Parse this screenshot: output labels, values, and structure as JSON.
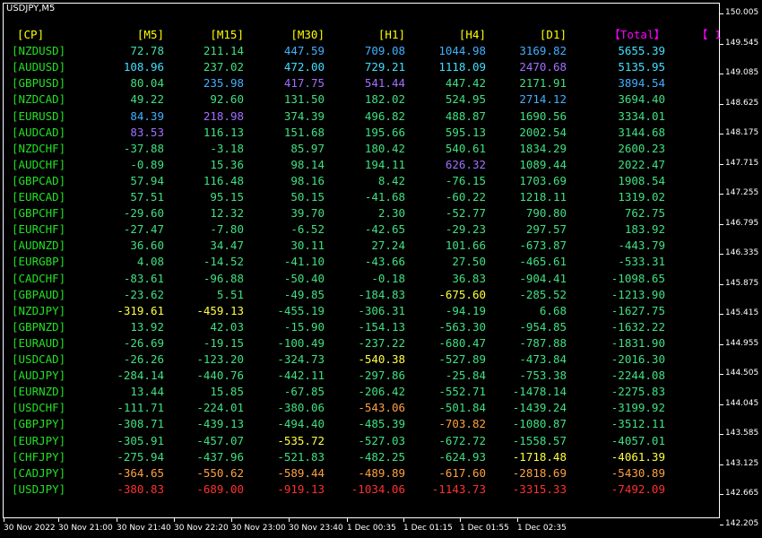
{
  "title": "USDJPY,M5",
  "headers": [
    "[CP]",
    "[M5]",
    "[M15]",
    "[M30]",
    "[H1]",
    "[H4]",
    "[D1]",
    "【Total】",
    "【 1"
  ],
  "header_colors": [
    "#ffff00",
    "#ffff00",
    "#ffff00",
    "#ffff00",
    "#ffff00",
    "#ffff00",
    "#ffff00",
    "#ff00ff",
    "#ff00ff"
  ],
  "rows": [
    {
      "pair": "[NZDUSD]",
      "values": [
        "72.78",
        "211.14",
        "447.59",
        "709.08",
        "1044.98",
        "3169.82",
        "5655.39"
      ],
      "colors": [
        "#40e0b0",
        "#40e080",
        "#40b0ff",
        "#40b0ff",
        "#40b0ff",
        "#40b0ff",
        "#40e0ff"
      ]
    },
    {
      "pair": "[AUDUSD]",
      "values": [
        "108.96",
        "237.02",
        "472.00",
        "729.21",
        "1118.09",
        "2470.68",
        "5135.95"
      ],
      "colors": [
        "#40e0ff",
        "#40e080",
        "#40e0ff",
        "#40e0ff",
        "#40e0ff",
        "#a070ff",
        "#40e0ff"
      ]
    },
    {
      "pair": "[GBPUSD]",
      "values": [
        "80.04",
        "235.98",
        "417.75",
        "541.44",
        "447.42",
        "2171.91",
        "3894.54"
      ],
      "colors": [
        "#40e080",
        "#40b0ff",
        "#a070ff",
        "#a070ff",
        "#40e080",
        "#40e080",
        "#40b0ff"
      ]
    },
    {
      "pair": "[NZDCAD]",
      "values": [
        "49.22",
        "92.60",
        "131.50",
        "182.02",
        "524.95",
        "2714.12",
        "3694.40"
      ],
      "colors": [
        "#40e080",
        "#40e080",
        "#40e080",
        "#40e080",
        "#40e080",
        "#40b0ff",
        "#40e080"
      ]
    },
    {
      "pair": "[EURUSD]",
      "values": [
        "84.39",
        "218.98",
        "374.39",
        "496.82",
        "488.87",
        "1690.56",
        "3334.01"
      ],
      "colors": [
        "#40b0ff",
        "#a070ff",
        "#40e080",
        "#40e080",
        "#40e080",
        "#40e080",
        "#40e080"
      ]
    },
    {
      "pair": "[AUDCAD]",
      "values": [
        "83.53",
        "116.13",
        "151.68",
        "195.66",
        "595.13",
        "2002.54",
        "3144.68"
      ],
      "colors": [
        "#a070ff",
        "#40e080",
        "#40e080",
        "#40e080",
        "#40e080",
        "#40e080",
        "#40e080"
      ]
    },
    {
      "pair": "[NZDCHF]",
      "values": [
        "-37.88",
        "-3.18",
        "85.97",
        "180.42",
        "540.61",
        "1834.29",
        "2600.23"
      ],
      "colors": [
        "#40e080",
        "#40e080",
        "#40e080",
        "#40e080",
        "#40e080",
        "#40e080",
        "#40e080"
      ]
    },
    {
      "pair": "[AUDCHF]",
      "values": [
        "-0.89",
        "15.36",
        "98.14",
        "194.11",
        "626.32",
        "1089.44",
        "2022.47"
      ],
      "colors": [
        "#40e080",
        "#40e080",
        "#40e080",
        "#40e080",
        "#a070ff",
        "#40e080",
        "#40e080"
      ]
    },
    {
      "pair": "[GBPCAD]",
      "values": [
        "57.94",
        "116.48",
        "98.16",
        "8.42",
        "-76.15",
        "1703.69",
        "1908.54"
      ],
      "colors": [
        "#40e080",
        "#40e080",
        "#40e080",
        "#40e080",
        "#40e080",
        "#40e080",
        "#40e080"
      ]
    },
    {
      "pair": "[EURCAD]",
      "values": [
        "57.51",
        "95.15",
        "50.15",
        "-41.68",
        "-60.22",
        "1218.11",
        "1319.02"
      ],
      "colors": [
        "#40e080",
        "#40e080",
        "#40e080",
        "#40e080",
        "#40e080",
        "#40e080",
        "#40e080"
      ]
    },
    {
      "pair": "[GBPCHF]",
      "values": [
        "-29.60",
        "12.32",
        "39.70",
        "2.30",
        "-52.77",
        "790.80",
        "762.75"
      ],
      "colors": [
        "#40e080",
        "#40e080",
        "#40e080",
        "#40e080",
        "#40e080",
        "#40e080",
        "#40e080"
      ]
    },
    {
      "pair": "[EURCHF]",
      "values": [
        "-27.47",
        "-7.80",
        "-6.52",
        "-42.65",
        "-29.23",
        "297.57",
        "183.92"
      ],
      "colors": [
        "#40e080",
        "#40e080",
        "#40e080",
        "#40e080",
        "#40e080",
        "#40e080",
        "#40e080"
      ]
    },
    {
      "pair": "[AUDNZD]",
      "values": [
        "36.60",
        "34.47",
        "30.11",
        "27.24",
        "101.66",
        "-673.87",
        "-443.79"
      ],
      "colors": [
        "#40e080",
        "#40e080",
        "#40e080",
        "#40e080",
        "#40e080",
        "#40e080",
        "#40e080"
      ]
    },
    {
      "pair": "[EURGBP]",
      "values": [
        "4.08",
        "-14.52",
        "-41.10",
        "-43.66",
        "27.50",
        "-465.61",
        "-533.31"
      ],
      "colors": [
        "#40e080",
        "#40e080",
        "#40e080",
        "#40e080",
        "#40e080",
        "#40e080",
        "#40e080"
      ]
    },
    {
      "pair": "[CADCHF]",
      "values": [
        "-83.61",
        "-96.88",
        "-50.40",
        "-0.18",
        "36.83",
        "-904.41",
        "-1098.65"
      ],
      "colors": [
        "#40e080",
        "#40e080",
        "#40e080",
        "#40e080",
        "#40e080",
        "#40e080",
        "#40e080"
      ]
    },
    {
      "pair": "[GBPAUD]",
      "values": [
        "-23.62",
        "5.51",
        "-49.85",
        "-184.83",
        "-675.60",
        "-285.52",
        "-1213.90"
      ],
      "colors": [
        "#40e080",
        "#40e080",
        "#40e080",
        "#40e080",
        "#ffff40",
        "#40e080",
        "#40e080"
      ]
    },
    {
      "pair": "[NZDJPY]",
      "values": [
        "-319.61",
        "-459.13",
        "-455.19",
        "-306.31",
        "-94.19",
        "6.68",
        "-1627.75"
      ],
      "colors": [
        "#ffff40",
        "#ffff40",
        "#40e080",
        "#40e080",
        "#40e080",
        "#40e080",
        "#40e080"
      ]
    },
    {
      "pair": "[GBPNZD]",
      "values": [
        "13.92",
        "42.03",
        "-15.90",
        "-154.13",
        "-563.30",
        "-954.85",
        "-1632.22"
      ],
      "colors": [
        "#40e080",
        "#40e080",
        "#40e080",
        "#40e080",
        "#40e080",
        "#40e080",
        "#40e080"
      ]
    },
    {
      "pair": "[EURAUD]",
      "values": [
        "-26.69",
        "-19.15",
        "-100.49",
        "-237.22",
        "-680.47",
        "-787.88",
        "-1831.90"
      ],
      "colors": [
        "#40e080",
        "#40e080",
        "#40e080",
        "#40e080",
        "#40e080",
        "#40e080",
        "#40e080"
      ]
    },
    {
      "pair": "[USDCAD]",
      "values": [
        "-26.26",
        "-123.20",
        "-324.73",
        "-540.38",
        "-527.89",
        "-473.84",
        "-2016.30"
      ],
      "colors": [
        "#40e080",
        "#40e080",
        "#40e080",
        "#ffff40",
        "#40e080",
        "#40e080",
        "#40e080"
      ]
    },
    {
      "pair": "[AUDJPY]",
      "values": [
        "-284.14",
        "-440.76",
        "-442.11",
        "-297.86",
        "-25.84",
        "-753.38",
        "-2244.08"
      ],
      "colors": [
        "#40e080",
        "#40e080",
        "#40e080",
        "#40e080",
        "#40e080",
        "#40e080",
        "#40e080"
      ]
    },
    {
      "pair": "[EURNZD]",
      "values": [
        "13.44",
        "15.85",
        "-67.85",
        "-206.42",
        "-552.71",
        "-1478.14",
        "-2275.83"
      ],
      "colors": [
        "#40e080",
        "#40e080",
        "#40e080",
        "#40e080",
        "#40e080",
        "#40e080",
        "#40e080"
      ]
    },
    {
      "pair": "[USDCHF]",
      "values": [
        "-111.71",
        "-224.01",
        "-380.06",
        "-543.06",
        "-501.84",
        "-1439.24",
        "-3199.92"
      ],
      "colors": [
        "#40e080",
        "#40e080",
        "#40e080",
        "#ffa040",
        "#40e080",
        "#40e080",
        "#40e080"
      ]
    },
    {
      "pair": "[GBPJPY]",
      "values": [
        "-308.71",
        "-439.13",
        "-494.40",
        "-485.39",
        "-703.82",
        "-1080.87",
        "-3512.11"
      ],
      "colors": [
        "#40e080",
        "#40e080",
        "#40e080",
        "#40e080",
        "#ffa040",
        "#40e080",
        "#40e080"
      ]
    },
    {
      "pair": "[EURJPY]",
      "values": [
        "-305.91",
        "-457.07",
        "-535.72",
        "-527.03",
        "-672.72",
        "-1558.57",
        "-4057.01"
      ],
      "colors": [
        "#40e080",
        "#40e080",
        "#ffff40",
        "#40e080",
        "#40e080",
        "#40e080",
        "#40e080"
      ]
    },
    {
      "pair": "[CHFJPY]",
      "values": [
        "-275.94",
        "-437.96",
        "-521.83",
        "-482.25",
        "-624.93",
        "-1718.48",
        "-4061.39"
      ],
      "colors": [
        "#40e080",
        "#40e080",
        "#40e080",
        "#40e080",
        "#40e080",
        "#ffff40",
        "#ffff40"
      ]
    },
    {
      "pair": "[CADJPY]",
      "values": [
        "-364.65",
        "-550.62",
        "-589.44",
        "-489.89",
        "-617.60",
        "-2818.69",
        "-5430.89"
      ],
      "colors": [
        "#ffa040",
        "#ffa040",
        "#ffa040",
        "#ffa040",
        "#ffa040",
        "#ffa040",
        "#ffa040"
      ]
    },
    {
      "pair": "[USDJPY]",
      "values": [
        "-380.83",
        "-689.00",
        "-919.13",
        "-1034.06",
        "-1143.73",
        "-3315.33",
        "-7492.09"
      ],
      "colors": [
        "#ff3030",
        "#ff3030",
        "#ff3030",
        "#ff3030",
        "#ff3030",
        "#ff3030",
        "#ff3030"
      ]
    }
  ],
  "price_axis": [
    "150.005",
    "149.545",
    "149.085",
    "148.625",
    "148.175",
    "147.715",
    "147.255",
    "146.795",
    "146.335",
    "145.875",
    "145.415",
    "144.955",
    "144.505",
    "144.045",
    "143.585",
    "143.125",
    "142.665",
    "142.205"
  ],
  "time_axis": [
    "30 Nov 2022",
    "30 Nov 21:00",
    "30 Nov 21:40",
    "30 Nov 22:20",
    "30 Nov 23:00",
    "30 Nov 23:40",
    "1 Dec 00:35",
    "1 Dec 01:15",
    "1 Dec 01:55",
    "1 Dec 02:35"
  ]
}
